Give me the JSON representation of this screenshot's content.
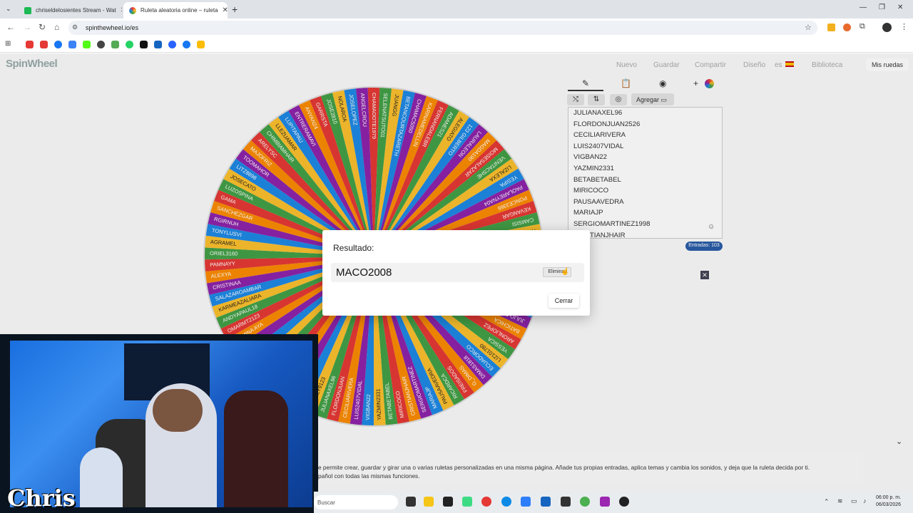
{
  "browser": {
    "tabs": [
      {
        "label": "chriseldelosientes Stream - Wat",
        "active": false,
        "favicon_color": "#1db954"
      },
      {
        "label": "Ruleta aleatoria online – ruleta",
        "active": true,
        "favicon_color": "#e53935"
      }
    ],
    "url": "spinthewheel.io/es"
  },
  "site": {
    "logo": "SpinWheel",
    "nav": [
      "Nuevo",
      "Guardar",
      "Compartir",
      "Diseño",
      "es",
      "Biblioteca"
    ],
    "mis_ruedas": "Mis ruedas",
    "agregar": "Agregar",
    "entries": [
      "JULIANAXEL96",
      "FLORDONJUAN2526",
      "CECILIARIVERA",
      "LUIS2407VIDAL",
      "VIGBAN22",
      "YAZMIN2331",
      "BETABETABEL",
      "MIRICOCO",
      "PAUSAAVEDRA",
      "MARIAJP",
      "SERGIOMARTINEZ1998",
      "CRISTIANJHAIR"
    ],
    "entries_count": "Entradas: 103",
    "description_line1": "e permite crear, guardar y girar una o varias ruletas personalizadas en una misma página. Añade tus propias entradas, aplica temas y cambia los sonidos, y deja que la ruleta decida por ti.",
    "description_line2": "pañol con todas las mismas funciones."
  },
  "wheel": {
    "colors": [
      "#e53935",
      "#43a047",
      "#fbc02d",
      "#1e88e5",
      "#8e24aa",
      "#fb8c00"
    ],
    "labels": [
      "CHAMAOOTE1979",
      "SELENATSUTO01",
      "JUANGG",
      "BETANCOURTAZARETH",
      "CHAMAC5050",
      "KARINAMEDELLIN",
      "FERNANDALEBR",
      "ADANES21",
      "ALEGIATO",
      "123 GILBERTO",
      "LAURALEON",
      "MAGDA190",
      "MOISESALAZAR",
      "VENITACSHE",
      "LIZALEXA",
      "YESIPA",
      "PAOLAREYNA04",
      "PONCE3366",
      "KEVANGAR",
      "CAMSISI",
      "RICKAVILA",
      "LYAPARK",
      "BABYWALLS",
      "JULIOCESAR",
      "ANGELOSMIL",
      "CHICALEIMA",
      "ROLAND78",
      "NICOLEESTRADA",
      "JULIO-ESTRADA",
      "BATICHICA",
      "ARONLIOPEZ",
      "YESSICA",
      "LIZ101780",
      "ECUADORCO",
      "DIMAS1818",
      "G_DIMAS",
      "FREISADOS",
      "RICARDCA",
      "PAUSAAVEDRA",
      "MARIAJP",
      "SERGIOMARTINEZ",
      "CRISTIANJHAIR",
      "MIRICOCO",
      "BETABETABEL",
      "YAZMIN2331",
      "VIGBAN22",
      "LUIS2407VIDAL",
      "CECILIARIVERA",
      "FLORDONJUAN",
      "JULIANAXEL96",
      "CHARLY9123",
      "JUANRIO",
      "YATZIRI",
      "GERMANGO",
      "ANGELCOCO",
      "KIRAS22",
      "MARIANA_1990",
      "LALUISCHICA",
      "YANSIHZ",
      "YAZMINA AYA",
      "OMARMT2123",
      "ANDYAPAUL18",
      "KARMEAZALIARA",
      "SALAZAROAMBAR",
      "CRISTINAA",
      "ALEXYA",
      "PAMNAYY",
      "ORIEL3160",
      "AGRAMEL",
      "TONYLUSVI",
      "RGIRNUH",
      "SANCHEZGAR",
      "GAMA",
      "LUZOSPINA",
      "JOSECATO",
      "LITZ8898",
      "TOOMAHOR",
      "MAJOFRIZ",
      "ARELYSC",
      "CHIMBIAMHAIR",
      "LLEZUAMAR",
      "LUPITAPAU",
      "ENTRERAMAVI",
      "ANYAN24",
      "GARRSTA",
      "JOSE2810",
      "NOLAROA",
      "JOSELOPEZ",
      "ANGELCROU"
    ]
  },
  "dialog": {
    "title": "Resultado:",
    "value": "MACO2008",
    "remove": "Eliminar",
    "close": "Cerrar"
  },
  "stream": {
    "name": "Chris"
  },
  "taskbar": {
    "search": "Buscar",
    "time": "06:00 p. m.",
    "date": "06/03/2026"
  }
}
